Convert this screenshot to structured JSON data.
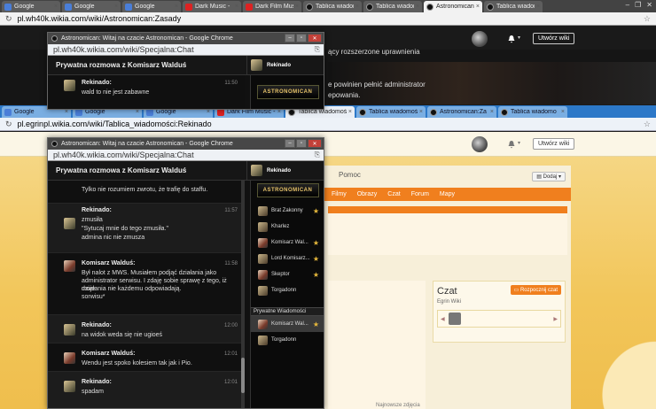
{
  "colors": {
    "accent_orange": "#f07f1e",
    "star": "#e6b83c",
    "chrome_blue": "#2c78c8"
  },
  "window1": {
    "tabs": [
      {
        "label": "Google",
        "icon": "google-icon"
      },
      {
        "label": "Google",
        "icon": "google-icon"
      },
      {
        "label": "Google",
        "icon": "google-icon"
      },
      {
        "label": "Dark Music -",
        "icon": "youtube-icon"
      },
      {
        "label": "Dark Film Musi",
        "icon": "youtube-icon"
      },
      {
        "label": "Tablica wiadomo",
        "icon": "wikia-icon"
      },
      {
        "label": "Tablica wiadomo",
        "icon": "wikia-icon"
      },
      {
        "label": "Astronomican:Z",
        "icon": "wikia-icon"
      },
      {
        "label": "Tablica wiadomo",
        "icon": "wikia-icon"
      }
    ],
    "url": "pl.wh40k.wikia.com/wiki/Astronomican:Zasady",
    "create_wiki": "Utwórz wiki",
    "page_lines": [
      "ący rozszerzone uprawnienia",
      "e powinien pełnić administrator",
      "epowania."
    ]
  },
  "window2": {
    "tabs": [
      {
        "label": "Google",
        "icon": "google-icon"
      },
      {
        "label": "Google",
        "icon": "google-icon"
      },
      {
        "label": "Google",
        "icon": "google-icon"
      },
      {
        "label": "Dark Film Music - Pa",
        "icon": "youtube-icon"
      },
      {
        "label": "Tablica wiadomości",
        "icon": "wikia-icon"
      },
      {
        "label": "Tablica wiadomości",
        "icon": "wikia-icon"
      },
      {
        "label": "Astronomican:Za",
        "icon": "wikia-icon"
      },
      {
        "label": "Tablica wiadomo",
        "icon": "wikia-icon"
      }
    ],
    "url": "pl.egrinpl.wikia.com/wiki/Tablica_wiadomości:Rekinado",
    "create_wiki": "Utwórz wiki",
    "pomoc": "Pomoc",
    "dodaj": "Dodaj",
    "nav": [
      "Filmy",
      "Obrazy",
      "Czat",
      "Forum",
      "Mapy"
    ],
    "czat": {
      "title": "Czat",
      "sub": "Egrin Wiki",
      "button": "Rozpocznij czat"
    },
    "naj": "Najnowsze zdjęcia"
  },
  "popup_top": {
    "title": "Astronomican: Witaj na czacie Astronomican - Google Chrome",
    "url": "pl.wh40k.wikia.com/wiki/Specjalna:Chat",
    "chat_title": "Prywatna rozmowa z Komisarz Walduś",
    "me": "Rekinado",
    "logo": "ASTRONOMICAN",
    "message": {
      "name": "Rekinado:",
      "time": "11:50",
      "text": "wald to nie jest zabawne"
    }
  },
  "popup_main": {
    "title": "Astronomican: Witaj na czacie Astronomican - Google Chrome",
    "url": "pl.wh40k.wikia.com/wiki/Specjalna:Chat",
    "chat_title": "Prywatna rozmowa z Komisarz Walduś",
    "me": "Rekinado",
    "logo": "ASTRONOMICAN",
    "first_line": "Tylko nie rozumiem zwrotu, że trafię do staffu.",
    "messages": [
      {
        "name": "Rekinado:",
        "time": "11:57",
        "lines": [
          "zmusiła",
          "\"Sytucaj mnie do tego zmusiła.\"",
          "admina nic nie zmusza"
        ]
      },
      {
        "name": "Komisarz Walduś:",
        "time": "11:58",
        "lines": [
          "Był nalot z MWS. Musiałem podjąć działania jako",
          "administrator serwisu. I zdaję sobie sprawę z tego, iż moje",
          "działania nie każdemu odpowiadają.",
          "sorwisu*"
        ]
      },
      {
        "name": "Rekinado:",
        "time": "12:00",
        "lines": [
          "na widok weda się nie ugioeś"
        ]
      },
      {
        "name": "Komisarz Walduś:",
        "time": "12:01",
        "lines": [
          "Wendu jest spoko kolesiem tak jak i Pio."
        ]
      },
      {
        "name": "Rekinado:",
        "time": "12:01",
        "lines": [
          "spadam"
        ]
      }
    ],
    "users": [
      {
        "name": "Brat Zakonny",
        "star": true
      },
      {
        "name": "Kharlez",
        "star": false
      },
      {
        "name": "Komisarz Wal...",
        "star": true
      },
      {
        "name": "Lord Komisarz...",
        "star": true
      },
      {
        "name": "Skeptor",
        "star": true
      },
      {
        "name": "Torgadonn",
        "star": false
      }
    ],
    "private_header": "Prywatne Wiadomości",
    "private_users": [
      {
        "name": "Komisarz Wal...",
        "star": true
      },
      {
        "name": "Torgadonn",
        "star": false
      }
    ]
  }
}
